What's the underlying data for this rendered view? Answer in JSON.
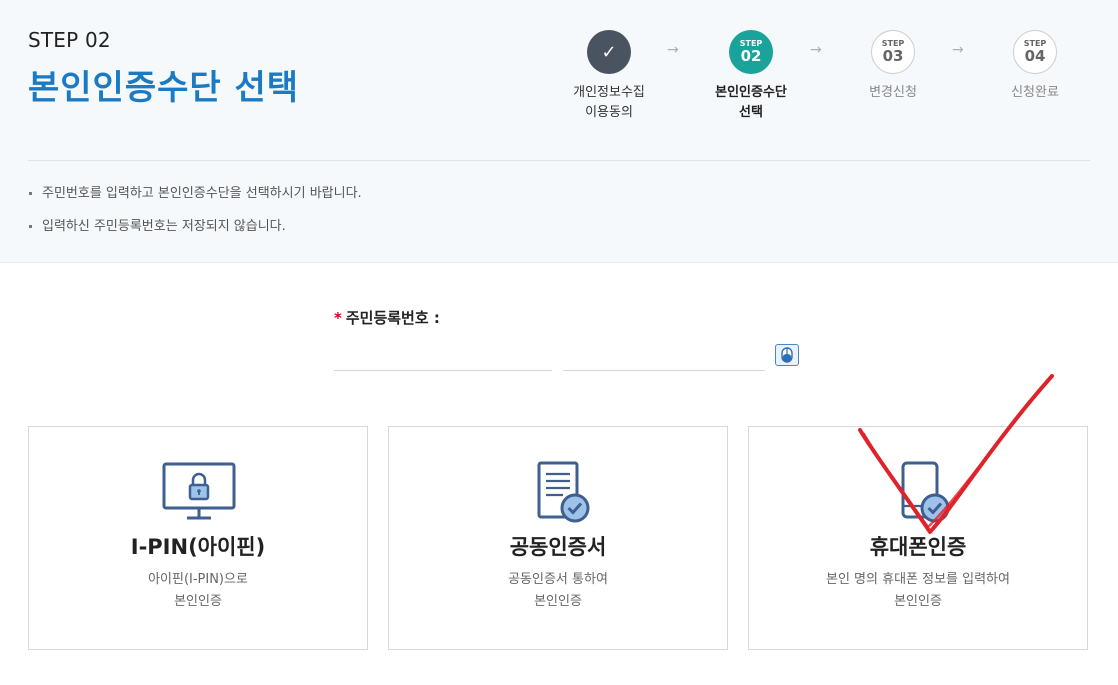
{
  "header": {
    "step_label": "STEP 02",
    "title": "본인인증수단 선택"
  },
  "stepper": {
    "steps": [
      {
        "badge_top": "",
        "badge_num": "✓",
        "name": "개인정보수집\n이용동의",
        "state": "done"
      },
      {
        "badge_top": "STEP",
        "badge_num": "02",
        "name": "본인인증수단\n선택",
        "state": "active"
      },
      {
        "badge_top": "STEP",
        "badge_num": "03",
        "name": "변경신청",
        "state": "pending"
      },
      {
        "badge_top": "STEP",
        "badge_num": "04",
        "name": "신청완료",
        "state": "pending"
      }
    ],
    "arrow": "→"
  },
  "notices": [
    "주민번호를 입력하고 본인인증수단을 선택하시기 바랍니다.",
    "입력하신 주민등록번호는 저장되지 않습니다."
  ],
  "rrn": {
    "required_mark": "*",
    "label": "주민등록번호 :",
    "first_value": "",
    "second_value": "",
    "keypad_icon": "mouse-keypad-icon"
  },
  "methods": [
    {
      "icon": "monitor-lock-icon",
      "title": "I-PIN(아이핀)",
      "desc": "아이핀(I-PIN)으로\n본인인증"
    },
    {
      "icon": "certificate-check-icon",
      "title": "공동인증서",
      "desc": "공동인증서 통하여\n본인인증"
    },
    {
      "icon": "phone-check-icon",
      "title": "휴대폰인증",
      "desc": "본인 명의 휴대폰 정보를 입력하여\n본인인증"
    }
  ],
  "colors": {
    "title_blue": "#1a7bc4",
    "active_step": "#1aa39a",
    "done_step": "#4a5360",
    "icon_blue": "#3f5f8f",
    "annotation_red": "#e0232a"
  }
}
